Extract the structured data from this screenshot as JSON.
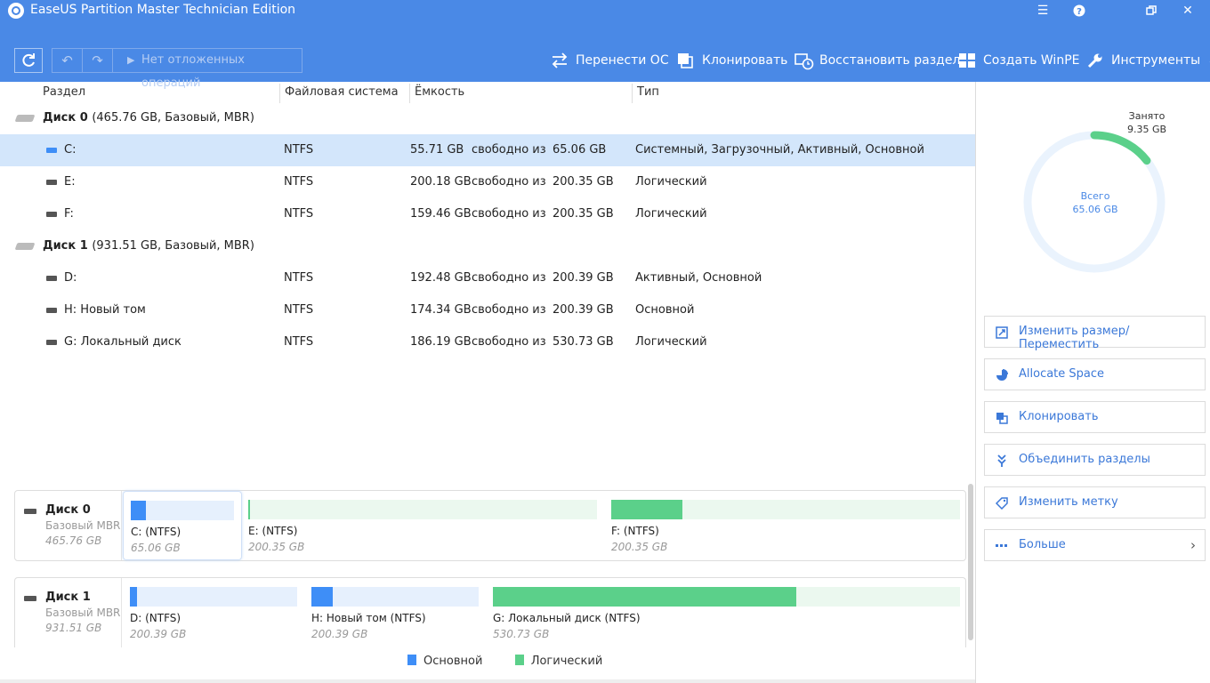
{
  "titlebar": {
    "title": "EaseUS Partition Master Technician Edition",
    "pending_label": "Нет отложенных операций",
    "tools": [
      {
        "label": "Перенести ОС",
        "icon": "transfer-icon"
      },
      {
        "label": "Клонировать",
        "icon": "clone-icon"
      },
      {
        "label": "Восстановить раздел",
        "icon": "recover-icon"
      },
      {
        "label": "Создать WinPE",
        "icon": "windows-icon"
      },
      {
        "label": "Инструменты",
        "icon": "wrench-icon"
      }
    ],
    "window_icons": [
      "menu-icon",
      "help-icon",
      "restore-icon",
      "close-icon"
    ]
  },
  "columns": {
    "partition": "Раздел",
    "fs": "Файловая система",
    "capacity": "Ёмкость",
    "type": "Тип"
  },
  "disks": [
    {
      "name": "Диск 0",
      "info": "(465.76 GB, Базовый, MBR)",
      "partitions": [
        {
          "name": "C:",
          "fs": "NTFS",
          "free": "55.71 GB",
          "mid": "свободно из",
          "total": "65.06 GB",
          "type": "Системный, Загрузочный, Активный, Основной"
        },
        {
          "name": "E:",
          "fs": "NTFS",
          "free": "200.18 GB",
          "mid": "свободно из",
          "total": "200.35 GB",
          "type": "Логический"
        },
        {
          "name": "F:",
          "fs": "NTFS",
          "free": "159.46 GB",
          "mid": "свободно из",
          "total": "200.35 GB",
          "type": "Логический"
        }
      ]
    },
    {
      "name": "Диск 1",
      "info": "(931.51 GB, Базовый, MBR)",
      "partitions": [
        {
          "name": "D:",
          "fs": "NTFS",
          "free": "192.48 GB",
          "mid": "свободно из",
          "total": "200.39 GB",
          "type": "Активный, Основной"
        },
        {
          "name": "H: Новый том",
          "fs": "NTFS",
          "free": "174.34 GB",
          "mid": "свободно из",
          "total": "200.39 GB",
          "type": "Основной"
        },
        {
          "name": "G: Локальный диск",
          "fs": "NTFS",
          "free": "186.19 GB",
          "mid": "свободно из",
          "total": "530.73 GB",
          "type": "Логический"
        }
      ]
    }
  ],
  "diskmaps": [
    {
      "name": "Диск 0",
      "kind": "Базовый MBR",
      "size": "465.76 GB",
      "segments": [
        {
          "label": "C:  (NTFS)",
          "size": "65.06 GB",
          "kind": "primary",
          "used_fraction": 0.144
        },
        {
          "label": "E:  (NTFS)",
          "size": "200.35 GB",
          "kind": "logical",
          "used_fraction": 0.002
        },
        {
          "label": "F:  (NTFS)",
          "size": "200.35 GB",
          "kind": "logical",
          "used_fraction": 0.204
        }
      ]
    },
    {
      "name": "Диск 1",
      "kind": "Базовый MBR",
      "size": "931.51 GB",
      "segments": [
        {
          "label": "D:  (NTFS)",
          "size": "200.39 GB",
          "kind": "primary",
          "used_fraction": 0.04
        },
        {
          "label": "H: Новый том (NTFS)",
          "size": "200.39 GB",
          "kind": "primary",
          "used_fraction": 0.13
        },
        {
          "label": "G: Локальный диск (NTFS)",
          "size": "530.73 GB",
          "kind": "logical",
          "used_fraction": 0.649
        }
      ]
    }
  ],
  "legend": {
    "primary": "Основной",
    "logical": "Логический"
  },
  "colors": {
    "accent": "#4a89e6",
    "primary": "#3e8ef7",
    "primary_bg": "#e6f0fd",
    "logical": "#5bd08a",
    "logical_bg": "#ebf8ef"
  },
  "usage": {
    "used_title": "Занято",
    "used": "9.35 GB",
    "total_title": "Всего",
    "total": "65.06 GB",
    "used_fraction": 0.1437
  },
  "actions": [
    {
      "label": "Изменить размер/Переместить",
      "icon": "resize-icon"
    },
    {
      "label": "Allocate Space",
      "icon": "pie-icon"
    },
    {
      "label": "Клонировать",
      "icon": "clone-icon"
    },
    {
      "label": "Объединить разделы",
      "icon": "merge-icon"
    },
    {
      "label": "Изменить метку",
      "icon": "tag-icon"
    },
    {
      "label": "Больше",
      "icon": "more-icon"
    }
  ]
}
